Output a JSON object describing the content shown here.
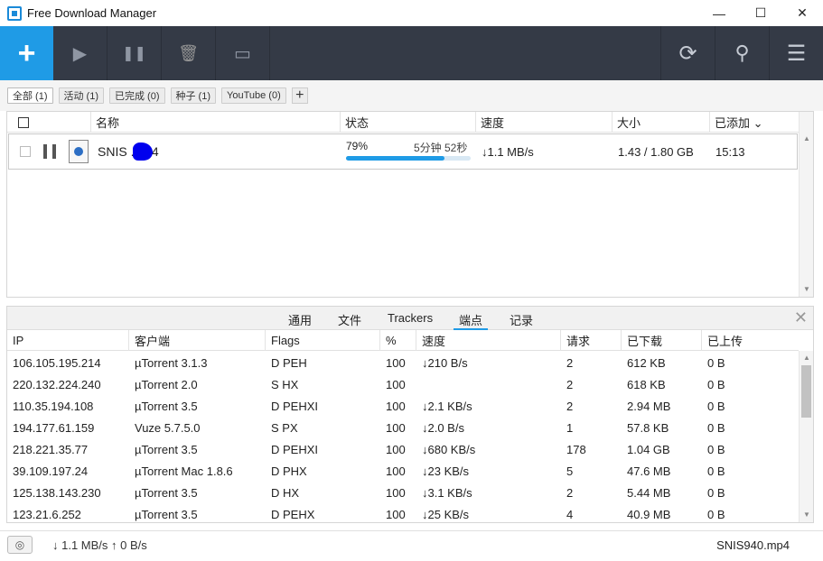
{
  "window": {
    "title": "Free Download Manager",
    "minimize": "—",
    "maximize": "☐",
    "close": "✕"
  },
  "toolbar": {
    "add": "+",
    "play": "▶",
    "pause": "❚❚",
    "delete": "🗑",
    "move": "▭",
    "refresh": "⟳",
    "search": "⚲",
    "menu": "☰"
  },
  "filters": [
    {
      "label": "全部 (1)",
      "active": true
    },
    {
      "label": "活动 (1)"
    },
    {
      "label": "已完成 (0)"
    },
    {
      "label": "种子 (1)"
    },
    {
      "label": "YouTube (0)"
    }
  ],
  "filter_add": "+",
  "downloads": {
    "columns": [
      "名称",
      "状态",
      "速度",
      "大小",
      "已添加 ⌄"
    ],
    "rows": [
      {
        "name": "SNIS   .mp4",
        "status_pct": "79%",
        "progress": 0.79,
        "eta": "5分钟 52秒",
        "speed": "↓1.1 MB/s",
        "size": "1.43 / 1.80 GB",
        "added": "15:13"
      }
    ]
  },
  "details": {
    "tabs": [
      "通用",
      "文件",
      "Trackers",
      "端点",
      "记录"
    ],
    "active_tab": 3,
    "close": "✕",
    "columns": [
      "IP",
      "客户端",
      "Flags",
      "%",
      "速度",
      "请求",
      "已下载",
      "已上传"
    ],
    "peers": [
      [
        "106.105.195.214",
        "µTorrent 3.1.3",
        "D PEH",
        "100",
        "↓210 B/s",
        "2",
        "612 KB",
        "0 B"
      ],
      [
        "220.132.224.240",
        "µTorrent 2.0",
        "S HX",
        "100",
        "",
        "2",
        "618 KB",
        "0 B"
      ],
      [
        "110.35.194.108",
        "µTorrent 3.5",
        "D PEHXI",
        "100",
        "↓2.1 KB/s",
        "2",
        "2.94 MB",
        "0 B"
      ],
      [
        "194.177.61.159",
        "Vuze 5.7.5.0",
        "S PX",
        "100",
        "↓2.0 B/s",
        "1",
        "57.8 KB",
        "0 B"
      ],
      [
        "218.221.35.77",
        "µTorrent 3.5",
        "D PEHXI",
        "100",
        "↓680 KB/s",
        "178",
        "1.04 GB",
        "0 B"
      ],
      [
        "39.109.197.24",
        "µTorrent Mac 1.8.6",
        "D PHX",
        "100",
        "↓23 KB/s",
        "5",
        "47.6 MB",
        "0 B"
      ],
      [
        "125.138.143.230",
        "µTorrent 3.5",
        "D HX",
        "100",
        "↓3.1 KB/s",
        "2",
        "5.44 MB",
        "0 B"
      ],
      [
        "123.21.6.252",
        "µTorrent 3.5",
        "D PEHX",
        "100",
        "↓25 KB/s",
        "4",
        "40.9 MB",
        "0 B"
      ]
    ]
  },
  "statusbar": {
    "speed": "↓ 1.1 MB/s  ↑ 0 B/s",
    "file": "SNIS940.mp4"
  }
}
